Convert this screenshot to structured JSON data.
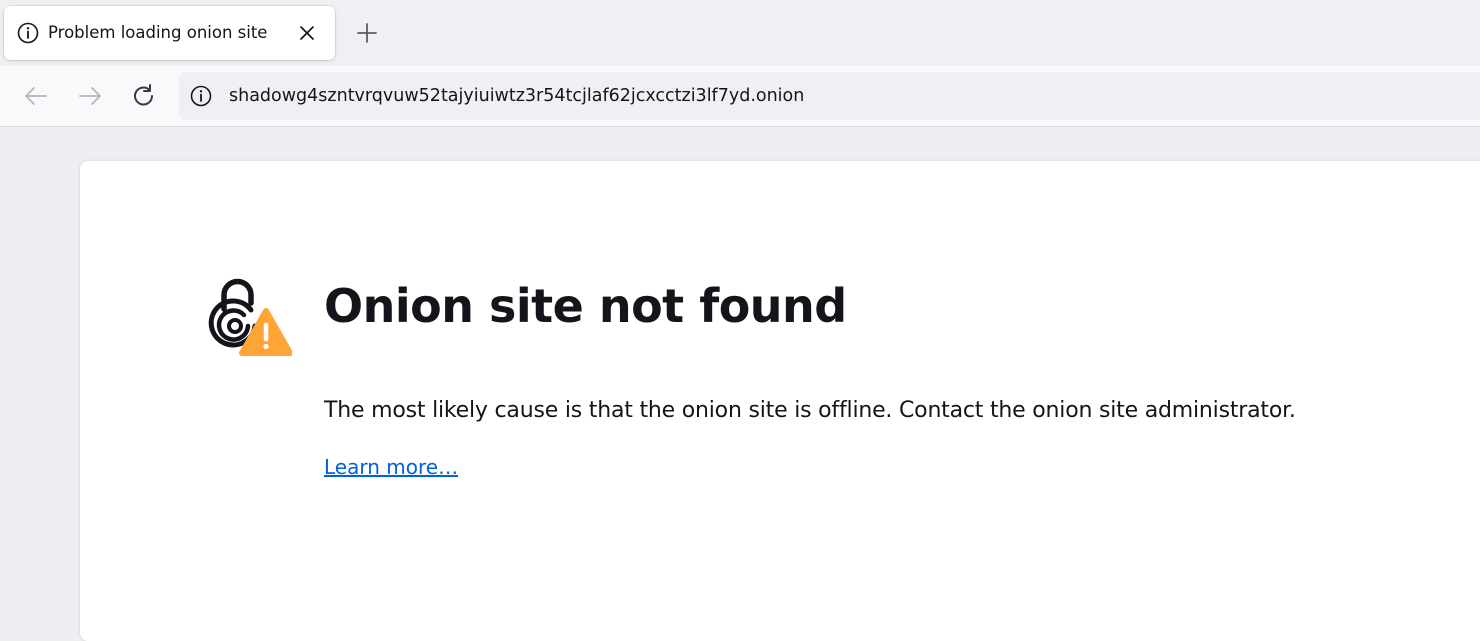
{
  "tab": {
    "title": "Problem loading onion site",
    "icon": "info-icon",
    "close_icon": "close-icon"
  },
  "new_tab_icon": "plus-icon",
  "nav": {
    "back_icon": "back-arrow-icon",
    "forward_icon": "forward-arrow-icon",
    "reload_icon": "reload-icon",
    "url": "shadowg4szntvrqvuw52tajyiuiwtz3r54tcjlaf62jcxcctzi3lf7yd.onion",
    "url_icon": "info-icon"
  },
  "error": {
    "icon": "onion-lock-warning-icon",
    "title": "Onion site not found",
    "description": "The most likely cause is that the onion site is offline. Contact the onion site administrator.",
    "link": "Learn more…"
  },
  "colors": {
    "warning": "#ffa436",
    "link": "#0061e0",
    "text": "#15141a"
  }
}
